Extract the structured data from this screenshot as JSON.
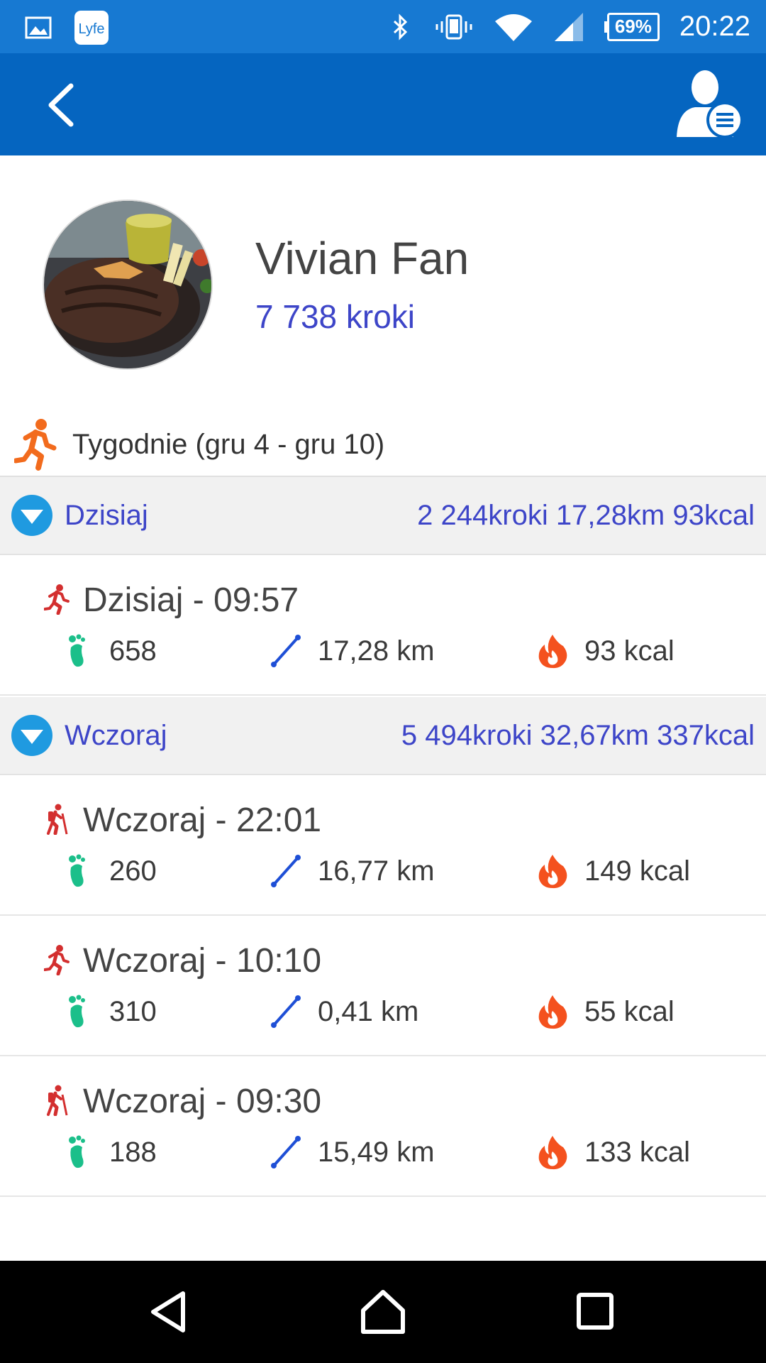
{
  "status_bar": {
    "battery": "69%",
    "time": "20:22",
    "icons": [
      "image-icon",
      "lyfe-app-icon",
      "bluetooth-icon",
      "vibrate-icon",
      "wifi-icon",
      "signal-icon",
      "battery-icon"
    ]
  },
  "app_bar": {
    "back_icon": "chevron-left-icon",
    "profile_menu_icon": "user-menu-icon"
  },
  "profile": {
    "name": "Vivian Fan",
    "steps": "7 738 kroki"
  },
  "week": {
    "label": "Tygodnie (gru 4 - gru 10)"
  },
  "groups": [
    {
      "title": "Dzisiaj",
      "summary": "2 244kroki 17,28km 93kcal",
      "entries": [
        {
          "title": "Dzisiaj - 09:57",
          "activity": "run",
          "steps": "658",
          "distance": "17,28 km",
          "calories": "93 kcal"
        }
      ]
    },
    {
      "title": "Wczoraj",
      "summary": "5 494kroki 32,67km 337kcal",
      "entries": [
        {
          "title": "Wczoraj - 22:01",
          "activity": "hike",
          "steps": "260",
          "distance": "16,77 km",
          "calories": "149 kcal"
        },
        {
          "title": "Wczoraj - 10:10",
          "activity": "run",
          "steps": "310",
          "distance": "0,41 km",
          "calories": "55 kcal"
        },
        {
          "title": "Wczoraj - 09:30",
          "activity": "hike",
          "steps": "188",
          "distance": "15,49 km",
          "calories": "133 kcal"
        }
      ]
    }
  ],
  "colors": {
    "status_bar": "#1779d2",
    "app_bar": "#0565c0",
    "accent_text": "#3d45c8",
    "activity_icon": "#d32f2f",
    "steps_icon": "#1bbf8a",
    "distance_icon": "#1e4fd6",
    "calories_icon": "#f4511e",
    "week_run_icon": "#f26b1d"
  }
}
